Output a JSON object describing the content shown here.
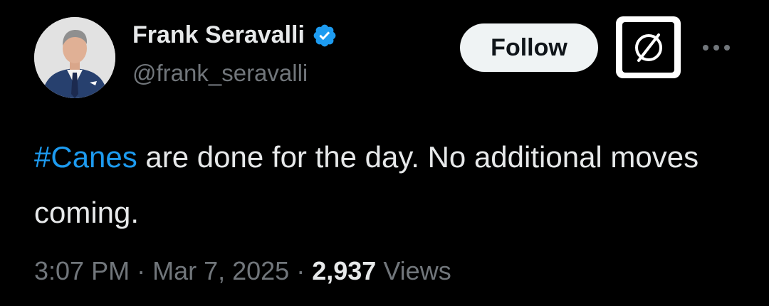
{
  "author": {
    "display_name": "Frank Seravalli",
    "handle": "@frank_seravalli",
    "verified": true
  },
  "actions": {
    "follow_label": "Follow",
    "grok_icon": "grok-icon",
    "more_icon": "more-dots-icon"
  },
  "tweet": {
    "hashtag": "#Canes",
    "text_rest": " are done for the day. No additional moves coming."
  },
  "meta": {
    "time": "3:07 PM",
    "separator": "·",
    "date": "Mar 7, 2025",
    "views_count": "2,937",
    "views_label": "Views"
  },
  "colors": {
    "background": "#000000",
    "text": "#e7e9ea",
    "secondary": "#71767b",
    "accent": "#1d9bf0",
    "follow_bg": "#eff3f4"
  }
}
